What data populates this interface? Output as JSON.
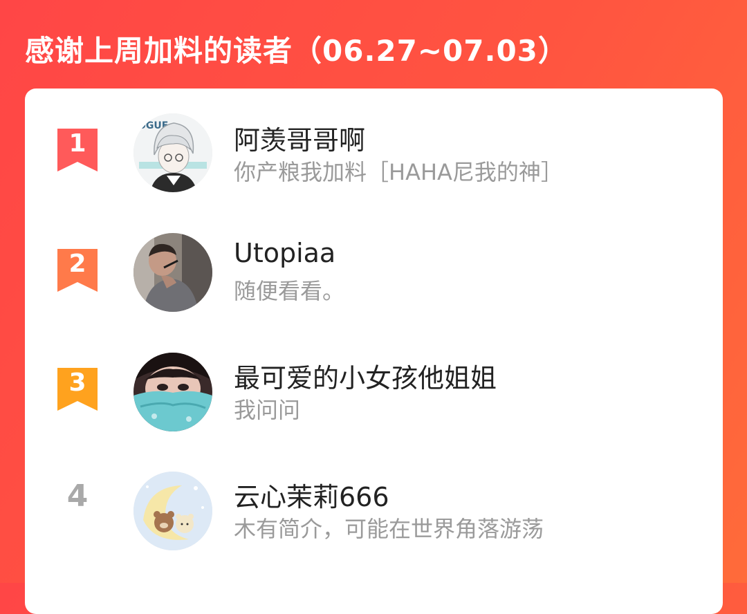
{
  "header": {
    "title": "感谢上周加料的读者（06.27~07.03）"
  },
  "colors": {
    "background_start": "#ff4646",
    "background_end": "#ff6b3a",
    "rank1": "#ff5a5a",
    "rank2": "#ff7a4a",
    "rank3": "#ffa21e",
    "rank_plain": "#a9a9a9"
  },
  "readers": [
    {
      "rank": "1",
      "name": "阿羡哥哥啊",
      "bio": "你产粮我加料［HAHA尼我的神］",
      "avatar_icon": "anime-white-hair-avatar-icon"
    },
    {
      "rank": "2",
      "name": "Utopiaa",
      "bio": "随便看看。",
      "avatar_icon": "man-photo-avatar-icon"
    },
    {
      "rank": "3",
      "name": "最可爱的小女孩他姐姐",
      "bio": "我问问",
      "avatar_icon": "girl-scarf-avatar-icon"
    },
    {
      "rank": "4",
      "name": "云心茉莉666",
      "bio": "木有简介，可能在世界角落游荡",
      "avatar_icon": "bears-moon-avatar-icon"
    }
  ]
}
